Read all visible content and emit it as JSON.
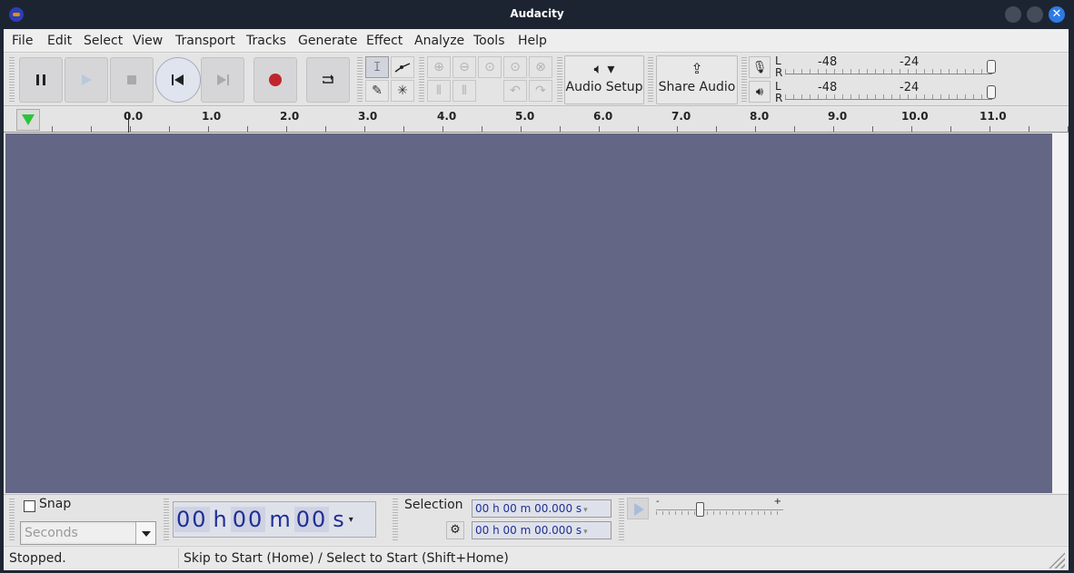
{
  "window": {
    "title": "Audacity"
  },
  "menu": [
    "File",
    "Edit",
    "Select",
    "View",
    "Transport",
    "Tracks",
    "Generate",
    "Effect",
    "Analyze",
    "Tools",
    "Help"
  ],
  "toolbar": {
    "audio_setup_label": "Audio Setup",
    "share_audio_label": "Share Audio",
    "meter_labels": [
      "-48",
      "-24"
    ],
    "lr": [
      "L",
      "R"
    ]
  },
  "ruler": {
    "ticks": [
      "0.0",
      "1.0",
      "2.0",
      "3.0",
      "4.0",
      "5.0",
      "6.0",
      "7.0",
      "8.0",
      "9.0",
      "10.0",
      "11.0"
    ]
  },
  "snap": {
    "label": "Snap",
    "checked": false,
    "unit": "Seconds"
  },
  "time": {
    "h": "00",
    "m": "00",
    "s": "00",
    "hu": "h",
    "mu": "m",
    "su": "s"
  },
  "selection": {
    "label": "Selection",
    "start": "00 h 00 m 00.000 s",
    "end": "00 h 00 m 00.000 s"
  },
  "play_speed": {
    "min": "-",
    "max": "+"
  },
  "status": {
    "state": "Stopped.",
    "hint": "Skip to Start (Home) / Select to Start (Shift+Home)"
  },
  "colors": {
    "track_bg": "#646685",
    "accent": "#2c7be5",
    "record": "#c0262d",
    "play_green": "#2cc43a"
  }
}
